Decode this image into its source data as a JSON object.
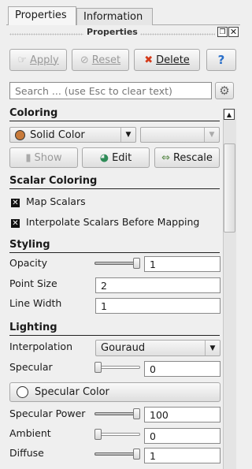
{
  "tabs": {
    "properties": "Properties",
    "information": "Information"
  },
  "panel_title": "Properties",
  "toolbar": {
    "apply": "Apply",
    "reset": "Reset",
    "delete": "Delete",
    "help": "?"
  },
  "search": {
    "placeholder": "Search ... (use Esc to clear text)"
  },
  "sections": {
    "coloring": "Coloring",
    "scalar_coloring": "Scalar Coloring",
    "styling": "Styling",
    "lighting": "Lighting"
  },
  "coloring": {
    "mode": "Solid Color",
    "second_combo": "",
    "show": "Show",
    "edit": "Edit",
    "rescale": "Rescale",
    "solid_color_hex": "#c87a3a"
  },
  "scalar_coloring": {
    "map_scalars": "Map Scalars",
    "interpolate": "Interpolate Scalars Before Mapping"
  },
  "styling": {
    "opacity_label": "Opacity",
    "opacity_value": "1",
    "opacity_level": 1.0,
    "point_size_label": "Point Size",
    "point_size_value": "2",
    "line_width_label": "Line Width",
    "line_width_value": "1"
  },
  "lighting": {
    "interpolation_label": "Interpolation",
    "interpolation_value": "Gouraud",
    "specular_label": "Specular",
    "specular_value": "0",
    "specular_level": 0.0,
    "specular_color": "Specular Color",
    "specular_power_label": "Specular Power",
    "specular_power_value": "100",
    "specular_power_level": 1.0,
    "ambient_label": "Ambient",
    "ambient_value": "0",
    "ambient_level": 0.0,
    "diffuse_label": "Diffuse",
    "diffuse_value": "1",
    "diffuse_level": 1.0
  }
}
